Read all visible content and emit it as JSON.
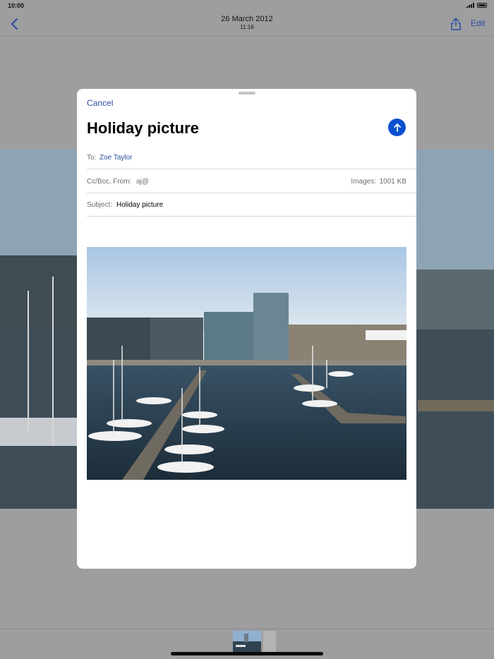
{
  "status_bar": {
    "time": "10:00"
  },
  "nav": {
    "date": "26 March 2012",
    "time": "11:16",
    "edit_label": "Edit"
  },
  "compose": {
    "cancel_label": "Cancel",
    "title": "Holiday picture",
    "to_label": "To:",
    "to_value": "Zoe Taylor",
    "cc_from_label": "Cc/Bcc, From:",
    "cc_from_value": "aj@",
    "images_label": "Images:",
    "images_size": "1001 KB",
    "subject_label": "Subject:",
    "subject_value": "Holiday picture"
  },
  "colors": {
    "accent": "#2a4fa0",
    "send": "#0b50d0",
    "backdrop": "#9e9ea0"
  },
  "icons": [
    "back-chevron-icon",
    "share-icon",
    "send-arrow-icon",
    "signal-icon",
    "battery-icon"
  ]
}
